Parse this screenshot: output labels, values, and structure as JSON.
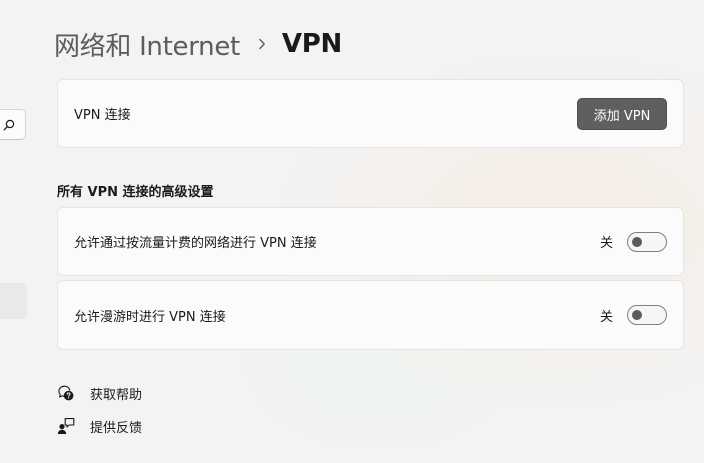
{
  "header": {
    "breadcrumb_parent": "网络和 Internet",
    "breadcrumb_current": "VPN",
    "separator_icon": "chevron-right-icon"
  },
  "sidebar": {
    "search_icon": "search-icon"
  },
  "vpn_connections": {
    "label": "VPN 连接",
    "add_button_label": "添加 VPN"
  },
  "advanced": {
    "title": "所有 VPN 连接的高级设置",
    "settings": [
      {
        "label": "允许通过按流量计费的网络进行 VPN 连接",
        "state_label": "关",
        "on": false
      },
      {
        "label": "允许漫游时进行 VPN 连接",
        "state_label": "关",
        "on": false
      }
    ]
  },
  "footer": {
    "help": {
      "label": "获取帮助",
      "icon": "help-chat-icon"
    },
    "feedback": {
      "label": "提供反馈",
      "icon": "feedback-icon"
    }
  },
  "colors": {
    "background": "#f3f3f3",
    "card": "#fbfbfb",
    "button": "#5f5f5f",
    "toggle_knob": "#5a5a5a"
  }
}
